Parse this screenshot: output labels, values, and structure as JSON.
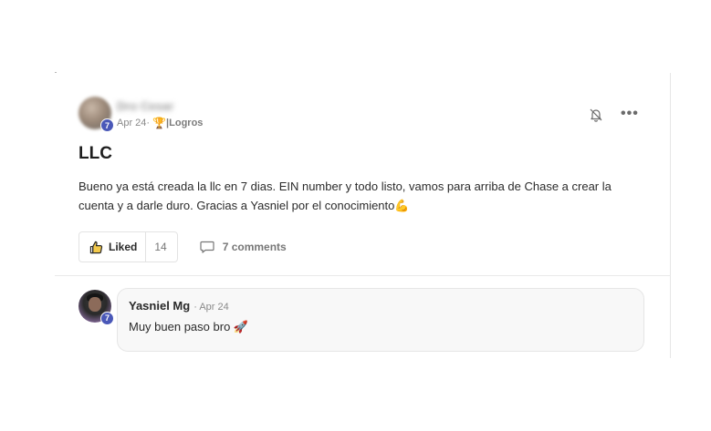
{
  "post": {
    "author_name": "Dro Cesar",
    "author_level": "7",
    "date": "Apr 24",
    "separator": " · ",
    "trophy_icon": "🏆",
    "category_separator": "| ",
    "category": "Logros",
    "title": "LLC",
    "body": "Bueno ya está creada la llc en 7 dias. EIN number y todo listo, vamos para arriba de Chase a crear la cuenta y a darle duro. Gracias a Yasniel por el conocimiento💪",
    "more_glyph": "•••"
  },
  "actions": {
    "like_label": "Liked",
    "like_count": "14",
    "comments_label": "7 comments"
  },
  "comment": {
    "author_name": "Yasniel Mg",
    "author_level": "7",
    "date": "· Apr 24",
    "text": "Muy buen paso bro 🚀"
  },
  "colors": {
    "level_badge": "#4a58b8",
    "bubble_bg": "#f8f8f8",
    "divider": "#e9e9e9"
  },
  "icons": {
    "bell": "bell-off-icon",
    "more": "more-horizontal-icon",
    "like": "thumbs-up-icon",
    "comments": "comment-bubble-icon",
    "trophy": "trophy-icon"
  }
}
